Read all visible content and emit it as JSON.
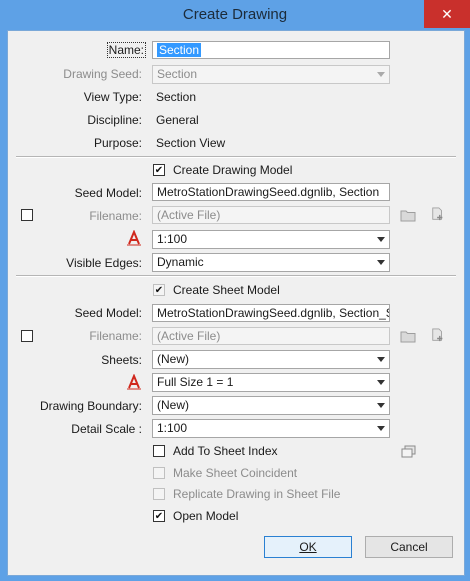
{
  "window": {
    "title": "Create Drawing",
    "close_glyph": "✕"
  },
  "general": {
    "name_label": "Name:",
    "name_value": "Section",
    "seed_label": "Drawing Seed:",
    "seed_value": "Section",
    "view_type_label": "View Type:",
    "view_type_value": "Section",
    "discipline_label": "Discipline:",
    "discipline_value": "General",
    "purpose_label": "Purpose:",
    "purpose_value": "Section View"
  },
  "drawing_model": {
    "create_label": "Create Drawing Model",
    "create_checked": true,
    "seed_label": "Seed Model:",
    "seed_value": "MetroStationDrawingSeed.dgnlib, Section",
    "filename_label": "Filename:",
    "filename_placeholder": "(Active File)",
    "scale_value": "1:100",
    "visible_edges_label": "Visible Edges:",
    "visible_edges_value": "Dynamic"
  },
  "sheet_model": {
    "create_label": "Create Sheet Model",
    "create_checked": true,
    "seed_label": "Seed Model:",
    "seed_value": "MetroStationDrawingSeed.dgnlib, Section_S",
    "filename_label": "Filename:",
    "filename_placeholder": "(Active File)",
    "sheets_label": "Sheets:",
    "sheets_value": "(New)",
    "scale_value": "Full Size 1 = 1",
    "boundary_label": "Drawing Boundary:",
    "boundary_value": "(New)",
    "detail_scale_label": "Detail Scale :",
    "detail_scale_value": "1:100"
  },
  "options": {
    "add_to_index": "Add To Sheet Index",
    "make_coincident": "Make Sheet Coincident",
    "replicate": "Replicate Drawing in Sheet File",
    "open_model": "Open Model"
  },
  "buttons": {
    "ok": "OK",
    "cancel": "Cancel"
  },
  "colors": {
    "titlebar": "#5ea1e6",
    "close": "#c9302c",
    "annotation_red": "#d0281d",
    "selection": "#3399ff"
  },
  "icons": [
    "folder-icon",
    "add-file-icon",
    "annotation-scale-icon",
    "sheet-index-icon",
    "close-icon"
  ]
}
